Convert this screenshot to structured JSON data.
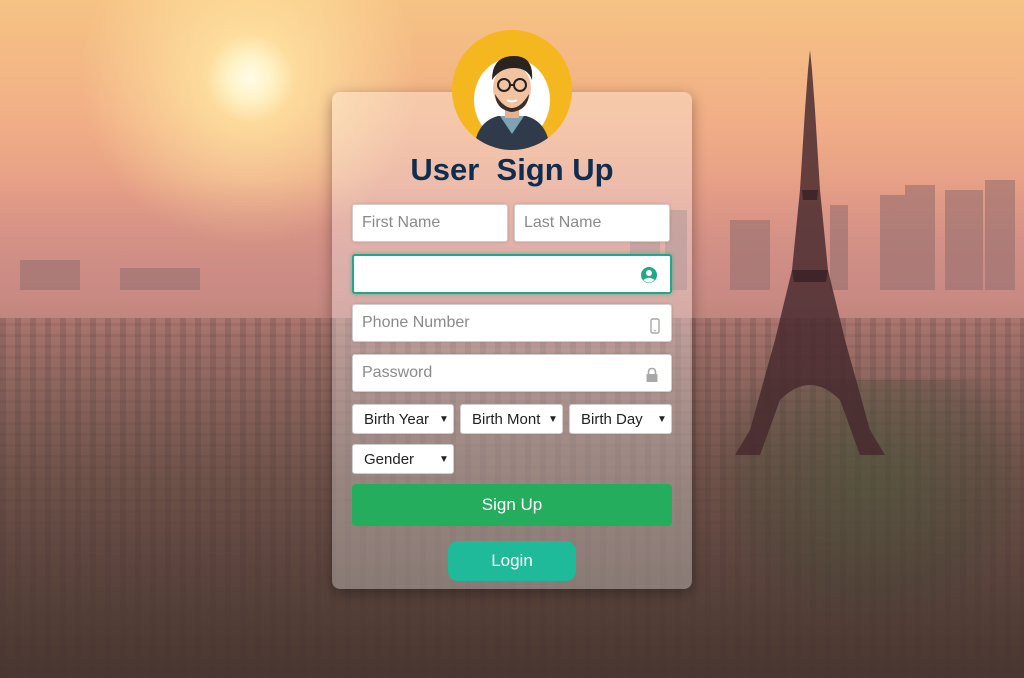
{
  "form": {
    "title": "User  Sign Up",
    "first_name_placeholder": "First Name",
    "last_name_placeholder": "Last Name",
    "username_value": "",
    "phone_placeholder": "Phone Number",
    "password_placeholder": "Password",
    "birth_year_selected": "Birth Year",
    "birth_month_selected": "Birth Mont",
    "birth_day_selected": "Birth Day",
    "gender_selected": "Gender",
    "signup_label": "Sign Up",
    "login_label": "Login"
  },
  "icons": {
    "username": "user-circle-icon",
    "phone": "mobile-phone-icon",
    "password": "lock-icon",
    "dropdown": "caret-down-icon"
  },
  "colors": {
    "title": "#0f2e4f",
    "focus_border": "#1fa889",
    "signup_button": "#25ad5e",
    "login_button": "#1fba9a",
    "avatar_background": "#f5b71f"
  }
}
